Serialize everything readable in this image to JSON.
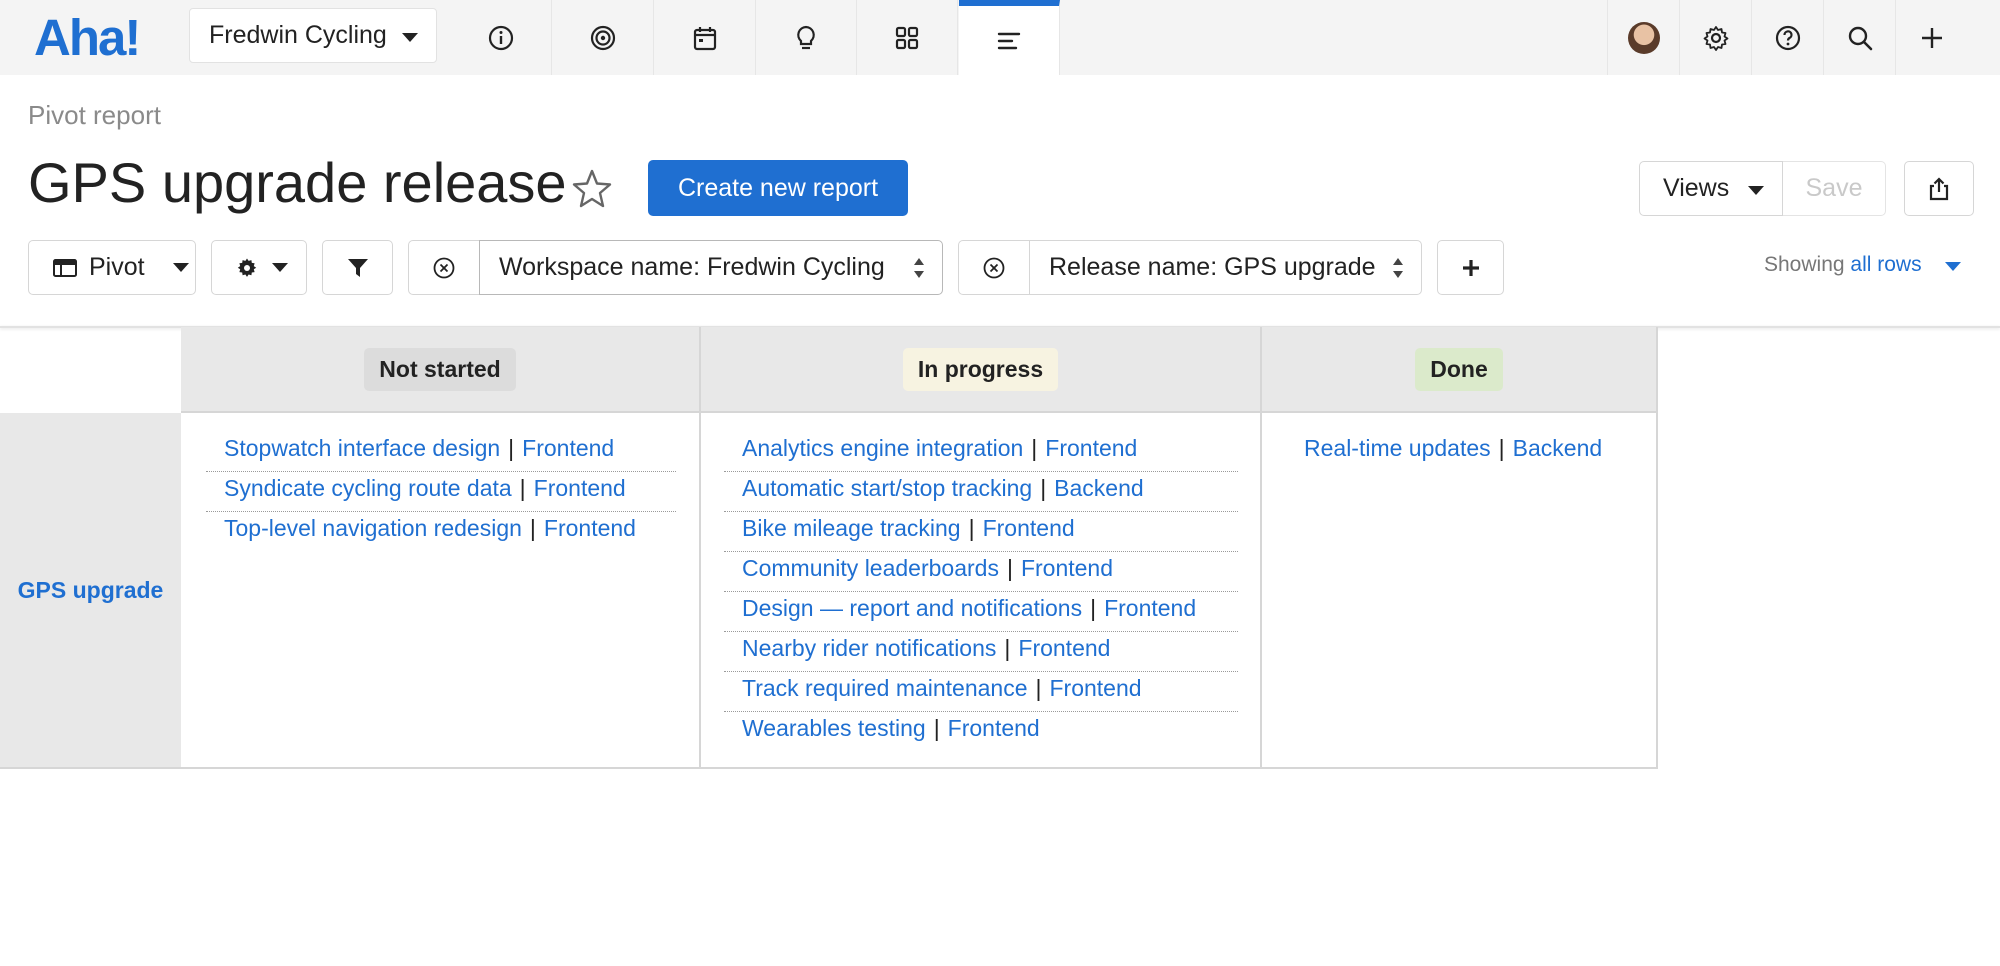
{
  "nav": {
    "logo": "Aha!",
    "workspace": "Fredwin Cycling",
    "tabs": [
      "overview-icon",
      "goals-icon",
      "calendar-icon",
      "ideas-icon",
      "apps-icon",
      "roadmap-icon"
    ],
    "active_tab": "roadmap-icon",
    "right_icons": [
      "avatar",
      "gear-icon",
      "help-icon",
      "search-icon",
      "plus-icon"
    ]
  },
  "header": {
    "breadcrumb": "Pivot report",
    "title": "GPS upgrade release",
    "create_label": "Create new report",
    "views_label": "Views",
    "save_label": "Save"
  },
  "toolbar": {
    "pivot_label": "Pivot",
    "filters": [
      {
        "label": "Workspace name: Fredwin Cycling"
      },
      {
        "label": "Release name: GPS upgrade"
      }
    ],
    "add_filter": "+",
    "showing_prefix": "Showing",
    "showing_link": "all rows"
  },
  "colors": {
    "accent": "#1f6fd1",
    "not_started": "#dcdcdc",
    "in_progress": "#f7f3e1",
    "done": "#dbeacb"
  },
  "pivot": {
    "row_header": "GPS upgrade",
    "columns": [
      {
        "status": "Not started",
        "items": [
          {
            "name": "Stopwatch interface design",
            "team": "Frontend"
          },
          {
            "name": "Syndicate cycling route data",
            "team": "Frontend"
          },
          {
            "name": "Top-level navigation redesign",
            "team": "Frontend"
          }
        ]
      },
      {
        "status": "In progress",
        "items": [
          {
            "name": "Analytics engine integration",
            "team": "Frontend"
          },
          {
            "name": "Automatic start/stop tracking",
            "team": "Backend"
          },
          {
            "name": "Bike mileage tracking",
            "team": "Frontend"
          },
          {
            "name": "Community leaderboards",
            "team": "Frontend"
          },
          {
            "name": "Design — report and notifications",
            "team": "Frontend"
          },
          {
            "name": "Nearby rider notifications",
            "team": "Frontend"
          },
          {
            "name": "Track required maintenance",
            "team": "Frontend"
          },
          {
            "name": "Wearables testing",
            "team": "Frontend"
          }
        ]
      },
      {
        "status": "Done",
        "items": [
          {
            "name": "Real-time updates",
            "team": "Backend"
          }
        ]
      }
    ]
  }
}
